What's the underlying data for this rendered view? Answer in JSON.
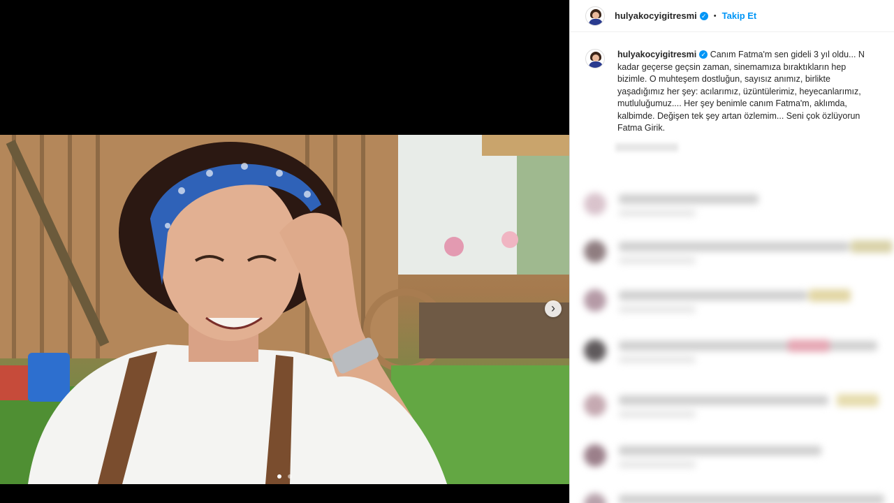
{
  "post": {
    "username": "hulyakocyigitresmi",
    "verified": true,
    "follow_label": "Takip Et",
    "separator": "•"
  },
  "caption": {
    "username": "hulyakocyigitresmi",
    "lines": [
      "Canım Fatma'm sen gideli 3 yıl oldu... N",
      "kadar geçerse geçsin zaman, sinemamıza bıraktıkların hep",
      "bizimle. O muhteşem dostluğun, sayısız anımız, birlikte",
      "yaşadığımız her şey: acılarımız, üzüntülerimiz, heyecanlarımız,",
      "mutluluğumuz.... Her şey benimle canım Fatma'm, aklımda,",
      "kalbimde. Değişen tek şey artan özlemim... Seni çok özlüyorun",
      "Fatma Girik."
    ]
  },
  "media": {
    "next_icon": "chevron-right-icon",
    "slide_count": 2,
    "active_slide": 1
  },
  "colors": {
    "accent": "#0095f6",
    "headband": "#2f62b8",
    "background_dark": "#000000"
  }
}
